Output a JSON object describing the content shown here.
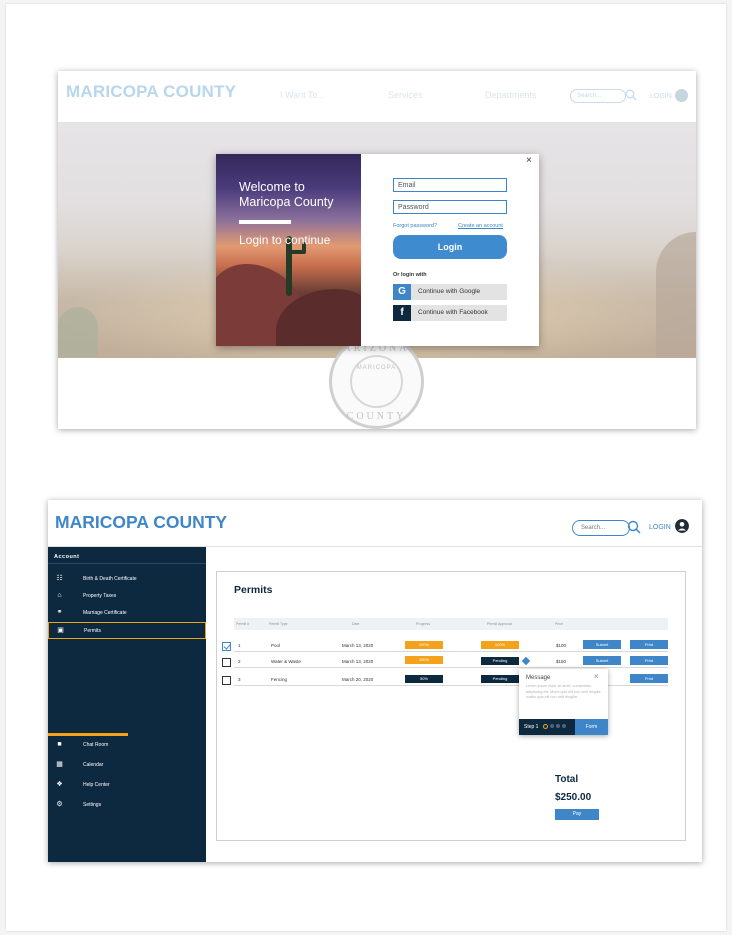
{
  "frame1": {
    "logo": "MARICOPA COUNTY",
    "nav": [
      "I Want To...",
      "Services",
      "Departments"
    ],
    "search_placeholder": "Search...",
    "login_label": "LOGIN",
    "seal": {
      "top": "ARIZONA",
      "bottom": "COUNTY",
      "ribbon": "MARICOPA"
    },
    "modal": {
      "close": "×",
      "welcome": "Welcome to Maricopa County",
      "subtitle": "Login to continue",
      "email_placeholder": "Email",
      "password_placeholder": "Password",
      "forgot": "Forgot password?",
      "create": "Create an account",
      "login_button": "Login",
      "or_login_with": "Or login with",
      "google": {
        "icon": "G",
        "label": "Continue with Google",
        "color": "#3f86c9"
      },
      "facebook": {
        "icon": "f",
        "label": "Continue with Facebook",
        "color": "#0d2940"
      }
    }
  },
  "frame2": {
    "logo": "MARICOPA COUNTY",
    "search_placeholder": "Search...",
    "login_label": "LOGIN",
    "sidebar": {
      "heading": "Account",
      "items": [
        {
          "label": "Birth & Death Certificate",
          "icon": "document-icon"
        },
        {
          "label": "Property Taxes",
          "icon": "home-icon"
        },
        {
          "label": "Marriage Certificate",
          "icon": "rings-icon"
        },
        {
          "label": "Permits",
          "icon": "permit-icon",
          "active": true
        }
      ],
      "bottom_items": [
        {
          "label": "Chat Room",
          "icon": "chat-icon"
        },
        {
          "label": "Calendar",
          "icon": "calendar-icon"
        },
        {
          "label": "Help Center",
          "icon": "help-icon"
        },
        {
          "label": "Settings",
          "icon": "gear-icon"
        }
      ]
    },
    "permits": {
      "title": "Permits",
      "columns": [
        "Permit #",
        "Permit Type",
        "Date",
        "Progress",
        "Permit Approval",
        "Price"
      ],
      "rows": [
        {
          "checked": true,
          "num": "1",
          "type": "Pool",
          "date": "March 13, 2020",
          "progress": "100%",
          "approval": "100%",
          "price": "$100",
          "submit": "Submit",
          "print": "Print"
        },
        {
          "checked": false,
          "num": "2",
          "type": "Water & Waste",
          "date": "March 13, 2020",
          "progress": "100%",
          "approval": "Pending",
          "price": "$150",
          "submit": "Submit",
          "print": "Print"
        },
        {
          "checked": false,
          "num": "3",
          "type": "Fencing",
          "date": "March 20, 2020",
          "progress": "50%",
          "approval": "Pending",
          "price": "",
          "submit": "",
          "print": "Print"
        }
      ]
    },
    "popup": {
      "title": "Message",
      "body": "Lorem ipsum dolor sit amet, consectetur adipiscing elit. Morbi quis elit non velit fringilla mattis quis elit non velit fringilla",
      "step": "Step 1",
      "form_button": "Form"
    },
    "total": {
      "label": "Total",
      "value": "$250.00",
      "pay": "Pay"
    },
    "colors": {
      "navy": "#0d2940",
      "blue": "#3f86c9",
      "orange": "#f5a21b"
    }
  }
}
